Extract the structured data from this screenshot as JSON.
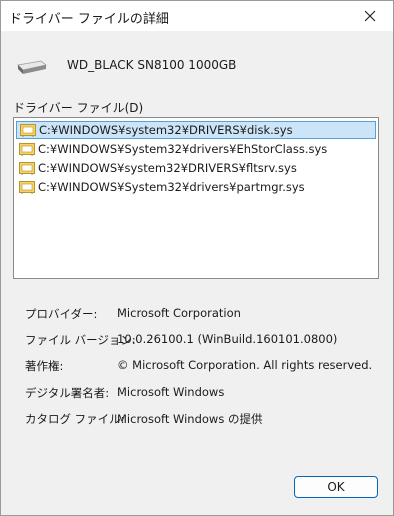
{
  "window": {
    "title": "ドライバー ファイルの詳細",
    "close_icon": "close-icon"
  },
  "device": {
    "icon": "drive-icon",
    "name": "WD_BLACK SN8100 1000GB"
  },
  "driver_files": {
    "label": "ドライバー ファイル(D)",
    "items": [
      {
        "path": "C:¥WINDOWS¥system32¥DRIVERS¥disk.sys",
        "icon": "driver-file-icon",
        "selected": true
      },
      {
        "path": "C:¥WINDOWS¥System32¥drivers¥EhStorClass.sys",
        "icon": "driver-file-icon",
        "selected": false
      },
      {
        "path": "C:¥WINDOWS¥system32¥DRIVERS¥fltsrv.sys",
        "icon": "driver-file-icon",
        "selected": false
      },
      {
        "path": "C:¥WINDOWS¥System32¥drivers¥partmgr.sys",
        "icon": "driver-file-icon",
        "selected": false
      }
    ]
  },
  "properties": [
    {
      "label": "プロバイダー:",
      "value": "Microsoft Corporation"
    },
    {
      "label": "ファイル バージョン:",
      "value": "10.0.26100.1 (WinBuild.160101.0800)"
    },
    {
      "label": "著作権:",
      "value": "© Microsoft Corporation. All rights reserved."
    },
    {
      "label": "デジタル署名者:",
      "value": "Microsoft Windows"
    },
    {
      "label": "カタログ ファイル:",
      "value": "Microsoft Windows の提供"
    }
  ],
  "buttons": {
    "ok": "OK"
  },
  "colors": {
    "selection_bg": "#cce4f7",
    "selection_border": "#5aa0d8",
    "accent": "#0067c0"
  }
}
